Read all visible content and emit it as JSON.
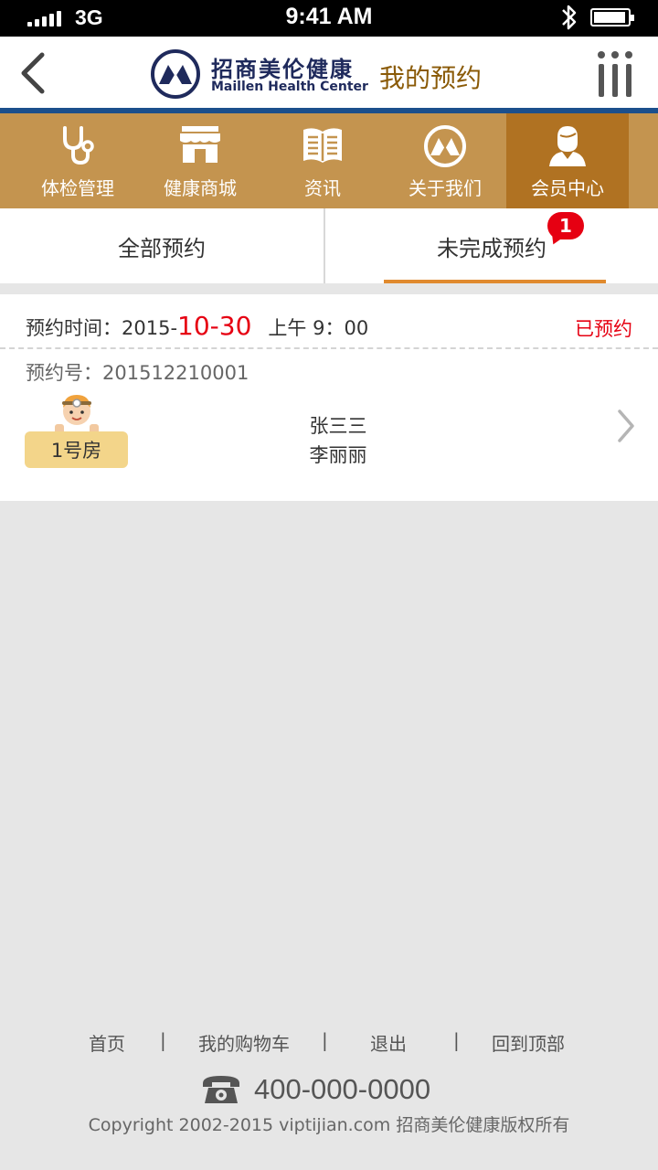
{
  "status_bar": {
    "network": "3G",
    "time": "9:41 AM"
  },
  "header": {
    "brand_cn": "招商美伦健康",
    "brand_en": "Maillen Health Center",
    "title": "我的预约"
  },
  "nav": {
    "items": [
      {
        "label": "体检管理",
        "icon": "stethoscope-icon"
      },
      {
        "label": "健康商城",
        "icon": "store-icon"
      },
      {
        "label": "资讯",
        "icon": "news-icon"
      },
      {
        "label": "关于我们",
        "icon": "logo-icon"
      },
      {
        "label": "会员中心",
        "icon": "user-icon",
        "active": true
      }
    ]
  },
  "tabs": {
    "all": "全部预约",
    "pending": "未完成预约",
    "pending_badge": "1"
  },
  "appointment": {
    "time_label": "预约时间：2015-",
    "month": "10",
    "dash": "-",
    "day": "30",
    "time_of_day": "上午 9：00",
    "status": "已预约",
    "order_no": "预约号：201512210001",
    "room": "1号房",
    "names": [
      "张三三",
      "李丽丽"
    ]
  },
  "footer": {
    "links": [
      "首页",
      "我的购物车",
      "退出",
      "回到顶部"
    ],
    "separators": [
      "|",
      "|",
      "|"
    ],
    "phone": "400-000-0000",
    "copyright": "Copyright 2002-2015 viptijian.com  招商美伦健康版权所有"
  },
  "colors": {
    "nav_bg": "#c4944f",
    "nav_active": "#b07222",
    "brand_blue": "#1f2a5c",
    "accent_red": "#e60012",
    "tab_underline": "#e08a2e"
  }
}
